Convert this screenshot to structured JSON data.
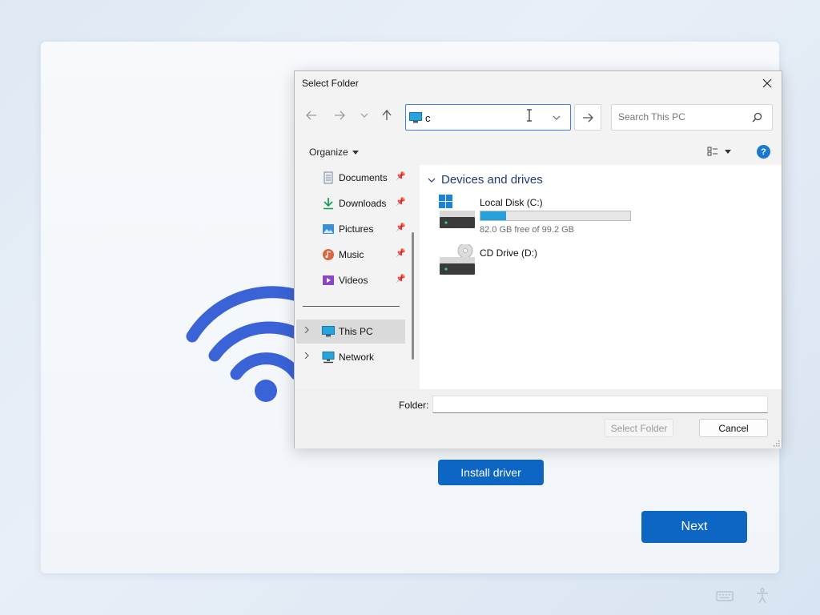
{
  "oobe": {
    "install_driver_label": "Install driver",
    "next_label": "Next",
    "accent_color": "#0e66c4",
    "wifi_color": "#3a63d8"
  },
  "dialog": {
    "title": "Select Folder",
    "address_value": "c",
    "search_placeholder": "Search This PC",
    "organize_label": "Organize",
    "help_label": "?",
    "nav_items": [
      {
        "label": "Documents",
        "icon": "documents-icon",
        "pinned": true
      },
      {
        "label": "Downloads",
        "icon": "downloads-icon",
        "pinned": true
      },
      {
        "label": "Pictures",
        "icon": "pictures-icon",
        "pinned": true
      },
      {
        "label": "Music",
        "icon": "music-icon",
        "pinned": true
      },
      {
        "label": "Videos",
        "icon": "videos-icon",
        "pinned": true
      },
      {
        "label": "This PC",
        "icon": "this-pc-icon",
        "selected": true
      },
      {
        "label": "Network",
        "icon": "network-icon"
      }
    ],
    "group_header": "Devices and drives",
    "drives": [
      {
        "name": "Local Disk (C:)",
        "free_text": "82.0 GB free of 99.2 GB",
        "used_fraction": 0.173
      },
      {
        "name": "CD Drive (D:)"
      }
    ],
    "folder_label": "Folder:",
    "folder_value": "",
    "select_folder_label": "Select Folder",
    "cancel_label": "Cancel"
  }
}
